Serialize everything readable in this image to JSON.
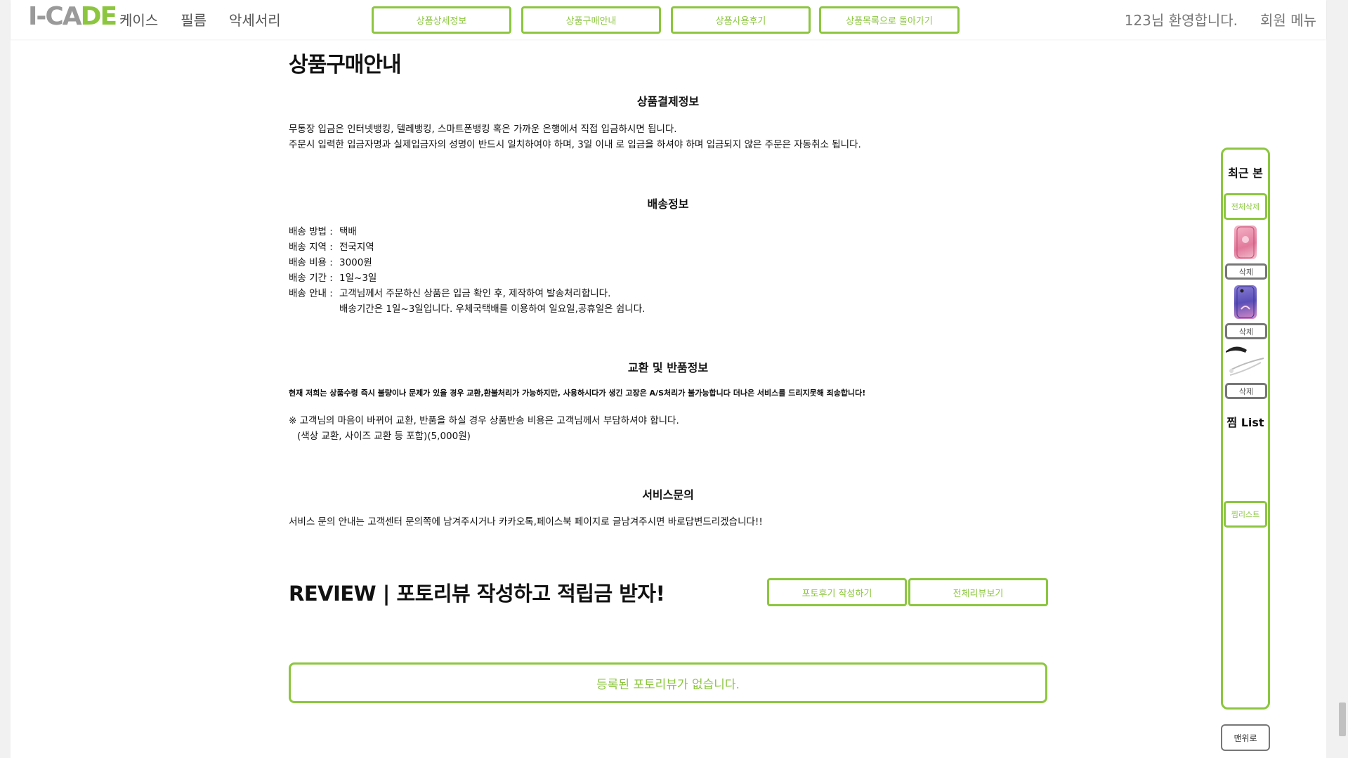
{
  "header": {
    "logo": {
      "part1": "I-CA",
      "part2": "DE"
    },
    "nav": [
      "케이스",
      "필름",
      "악세서리"
    ],
    "tabs": [
      "상품상세정보",
      "상품구매안내",
      "상품사용후기",
      "상품목록으로 돌아가기"
    ],
    "welcome": "123님 환영합니다.",
    "member_menu": "회원 메뉴"
  },
  "main": {
    "page_title": "상품구매안내",
    "payment": {
      "title": "상품결제정보",
      "line1": "무통장 입금은 인터넷뱅킹, 텔레뱅킹, 스마트폰뱅킹 혹은 가까운 은행에서 직접 입금하시면 됩니다.",
      "line2": "주문시 입력한 입금자명과 실제입금자의 성명이 반드시 일치하여야 하며, 3일 이내 로 입금을 하셔야 하며 입금되지 않은 주문은 자동취소 됩니다."
    },
    "shipping": {
      "title": "배송정보",
      "rows": [
        {
          "label": "배송 방법 :",
          "value": "택배"
        },
        {
          "label": "배송 지역 :",
          "value": "전국지역"
        },
        {
          "label": "배송 비용 :",
          "value": "3000원"
        },
        {
          "label": "배송 기간 :",
          "value": "1일~3일"
        },
        {
          "label": "배송 안내 :",
          "value": "고객님께서 주문하신 상품은 입금 확인 후, 제작하여 발송처리합니다."
        }
      ],
      "extra": "배송기간은 1일~3일입니다. 우체국택배를 이용하여 일요일,공휴일은 쉽니다."
    },
    "exchange": {
      "title": "교환 및 반품정보",
      "notice": "현재 저희는 상품수령 즉시 불량이나 문제가 있을 경우 교환,환불처리가 가능하지만, 사용하시다가 생긴 고장은 A/S처리가 불가능합니다 더나은 서비스를 드리지못해 죄송합니다!",
      "line1": "※ 고객님의 마음이 바뀌어 교환, 반품을 하실 경우 상품반송 비용은 고객님께서 부담하셔야 합니다.",
      "line2": "(색상 교환, 사이즈 교환 등 포함)(5,000원)"
    },
    "service": {
      "title": "서비스문의",
      "line": "서비스 문의 안내는 고객센터 문의쪽에 남겨주시거나 카카오톡,페이스북 페이지로 글남겨주시면 바로답변드리겠습니다!!"
    },
    "review": {
      "title": "REVIEW | 포토리뷰 작성하고 적립금 받자!",
      "write_btn": "포토후기 작성하기",
      "all_btn": "전체리뷰보기",
      "empty": "등록된 포토리뷰가 없습니다."
    }
  },
  "sidebar": {
    "recent_title": "최근 본",
    "delete_all": "전체삭제",
    "delete": "삭제",
    "wish_title": "찜 List",
    "wish_btn": "찜리스트",
    "top_btn": "맨위로"
  },
  "colors": {
    "accent": "#8cc63f"
  }
}
